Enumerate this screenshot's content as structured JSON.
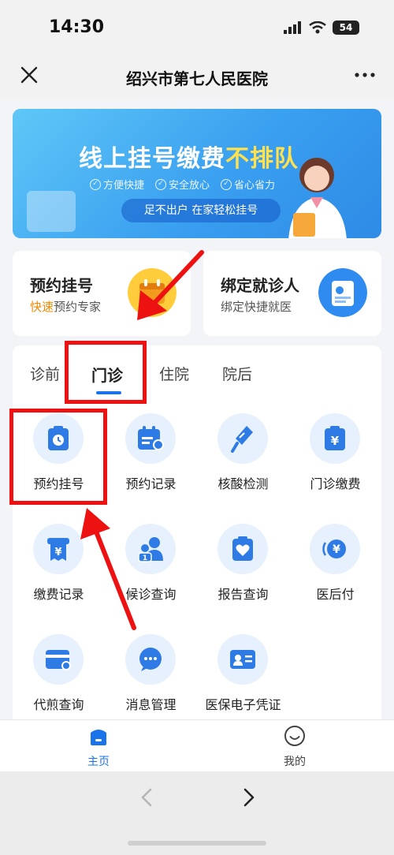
{
  "status_bar": {
    "time": "14:30",
    "battery": "54"
  },
  "nav": {
    "title": "绍兴市第七人民医院"
  },
  "banner": {
    "title_main": "线上挂号缴费",
    "title_highlight": "不排队",
    "tags": [
      "方便快捷",
      "安全放心",
      "省心省力"
    ],
    "pill": "足不出户  在家轻松挂号"
  },
  "quick": {
    "left": {
      "title": "预约挂号",
      "sub_highlight": "快速",
      "sub_rest": "预约专家"
    },
    "right": {
      "title": "绑定就诊人",
      "sub": "绑定快捷就医"
    }
  },
  "tabs": [
    "诊前",
    "门诊",
    "住院",
    "院后"
  ],
  "grid": [
    {
      "label": "预约挂号",
      "icon": "clock-clipboard-icon"
    },
    {
      "label": "预约记录",
      "icon": "calendar-icon"
    },
    {
      "label": "核酸检测",
      "icon": "swab-icon"
    },
    {
      "label": "门诊缴费",
      "icon": "payment-clipboard-icon"
    },
    {
      "label": "缴费记录",
      "icon": "receipt-icon"
    },
    {
      "label": "候诊查询",
      "icon": "people-queue-icon"
    },
    {
      "label": "报告查询",
      "icon": "heart-report-icon"
    },
    {
      "label": "医后付",
      "icon": "yen-coin-icon"
    },
    {
      "label": "代煎查询",
      "icon": "wallet-icon"
    },
    {
      "label": "消息管理",
      "icon": "chat-bubble-icon"
    },
    {
      "label": "医保电子凭证",
      "icon": "id-card-icon"
    }
  ],
  "tabbar": {
    "home": "主页",
    "me": "我的"
  },
  "colors": {
    "primary": "#1a73e8",
    "annotation": "#ee1111",
    "accent_orange": "#f08a00",
    "highlight_yellow": "#ffe14d"
  }
}
